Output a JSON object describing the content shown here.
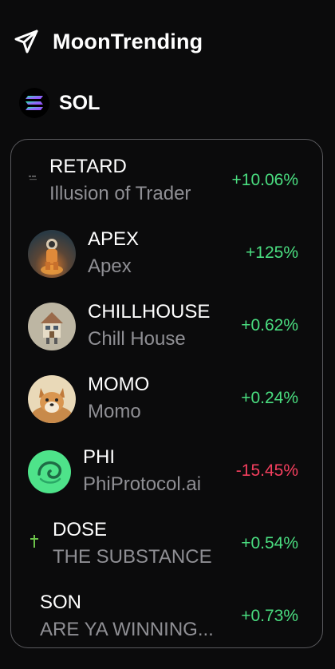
{
  "app": {
    "title": "MoonTrending",
    "logo_icon": "paper-plane-icon"
  },
  "chain": {
    "label": "SOL",
    "icon": "solana-logo-icon"
  },
  "colors": {
    "positive": "#4ade80",
    "negative": "#f43f5e",
    "background": "#0b0b0c"
  },
  "tokens": [
    {
      "symbol": "RETARD",
      "name": "Illusion of Trader",
      "change": "+10.06%",
      "direction": "up",
      "icon": "tiny-token-icon"
    },
    {
      "symbol": "APEX",
      "name": "Apex",
      "change": "+125%",
      "direction": "up",
      "icon": "astronaut-avatar-icon"
    },
    {
      "symbol": "CHILLHOUSE",
      "name": "Chill House",
      "change": "+0.62%",
      "direction": "up",
      "icon": "house-character-avatar-icon"
    },
    {
      "symbol": "MOMO",
      "name": "Momo",
      "change": "+0.24%",
      "direction": "up",
      "icon": "shiba-dog-avatar-icon"
    },
    {
      "symbol": "PHI",
      "name": "PhiProtocol.ai",
      "change": "-15.45%",
      "direction": "down",
      "icon": "green-swirl-logo-icon"
    },
    {
      "symbol": "DOSE",
      "name": "THE SUBSTANCE",
      "change": "+0.54%",
      "direction": "up",
      "icon": "syringe-icon"
    },
    {
      "symbol": "SON",
      "name": "ARE YA WINNING...",
      "change": "+0.73%",
      "direction": "up",
      "icon": ""
    }
  ]
}
